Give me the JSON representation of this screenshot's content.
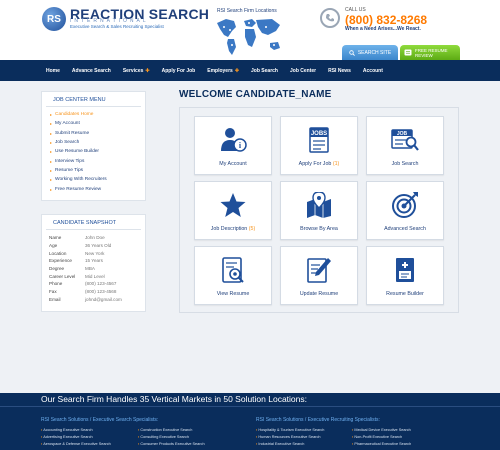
{
  "header": {
    "logo_letters": "RS",
    "logo_name": "REACTION SEARCH",
    "logo_sub": "INTERNATIONAL",
    "logo_tagline": "Executive Search & Sales Recruiting Specialist",
    "map_label": "RSI Search Firm Locations",
    "call_us": "CALL US",
    "phone": "(800) 832-8268",
    "phone_tagline": "When a Need Arises...We React.",
    "search_site": "SEARCH SITE",
    "free_review_1": "FREE RESUME",
    "free_review_2": "REVIEW"
  },
  "nav": {
    "items": [
      {
        "label": "Home"
      },
      {
        "label": "Advance Search"
      },
      {
        "label": "Services"
      },
      {
        "label": "Apply For Job"
      },
      {
        "label": "Employers"
      },
      {
        "label": "Job Search"
      },
      {
        "label": "Job Center"
      },
      {
        "label": "RSI News"
      },
      {
        "label": "Account"
      }
    ]
  },
  "sidebar": {
    "menu_title": "JOB CENTER MENU",
    "menu": [
      {
        "label": "Candidates Home"
      },
      {
        "label": "My Account"
      },
      {
        "label": "Submit Resume"
      },
      {
        "label": "Job Search"
      },
      {
        "label": "Use Resume Builder"
      },
      {
        "label": "Interview Tips"
      },
      {
        "label": "Resume Tips"
      },
      {
        "label": "Working With Recruiters"
      },
      {
        "label": "Free Resume Review"
      }
    ],
    "snapshot_title": "CANDIDATE SNAPSHOT",
    "snapshot": [
      {
        "key": "Name",
        "value": "John Doe"
      },
      {
        "key": "Age",
        "value": "36 Years Old"
      },
      {
        "key": "Location",
        "value": "New York"
      },
      {
        "key": "Experience",
        "value": "15 Years"
      },
      {
        "key": "Degree",
        "value": "MBA"
      },
      {
        "key": "Career Level",
        "value": "Mid Level"
      },
      {
        "key": "Phone",
        "value": "(800) 123-4567"
      },
      {
        "key": "Fax",
        "value": "(800) 123-4568"
      },
      {
        "key": "Email",
        "value": "johnd@gmail.com"
      }
    ]
  },
  "main": {
    "welcome": "WELCOME CANDIDATE_NAME",
    "tiles": [
      {
        "label": "My Account",
        "count": "",
        "icon": "user-info-icon"
      },
      {
        "label": "Apply For Job",
        "count": "(1)",
        "icon": "jobs-folder-icon"
      },
      {
        "label": "Job Search",
        "count": "",
        "icon": "job-search-icon"
      },
      {
        "label": "Job Description",
        "count": "(5)",
        "icon": "star-icon"
      },
      {
        "label": "Browse By Area",
        "count": "",
        "icon": "map-pin-icon"
      },
      {
        "label": "Advanced Search",
        "count": "",
        "icon": "target-icon"
      },
      {
        "label": "View Resume",
        "count": "",
        "icon": "view-resume-icon"
      },
      {
        "label": "Update Resume",
        "count": "",
        "icon": "edit-resume-icon"
      },
      {
        "label": "Resume Builder",
        "count": "",
        "icon": "resume-builder-icon"
      }
    ]
  },
  "footer": {
    "headline": "Our Search Firm Handles 35 Vertical Markets in 50 Solution Locations:",
    "col1_title": "RSI Search Solutions / Executive Search Specialists:",
    "col2_title": "RSI Search Solutions / Executive Recruiting Specialists:",
    "col1_links": [
      "Accounting Executive Search",
      "Advertising Executive Search",
      "Aerospace & Defense Executive Search"
    ],
    "col1b_links": [
      "Construction Executive Search",
      "Consulting Executive Search",
      "Consumer Products Executive Search"
    ],
    "col2_links": [
      "Hospitality & Tourism Executive Search",
      "Human Resources Executive Search",
      "Industrial Executive Search"
    ],
    "col2b_links": [
      "Medical Device Executive Search",
      "Non-Profit Executive Search",
      "Pharmaceutical Executive Search"
    ]
  },
  "colors": {
    "navy": "#0a2d5c",
    "accent_orange": "#f7941d",
    "link_blue": "#1f3f7a",
    "phone_orange": "#ff7a00",
    "green_button": "#5dab14",
    "blue_button": "#3b86cc"
  }
}
